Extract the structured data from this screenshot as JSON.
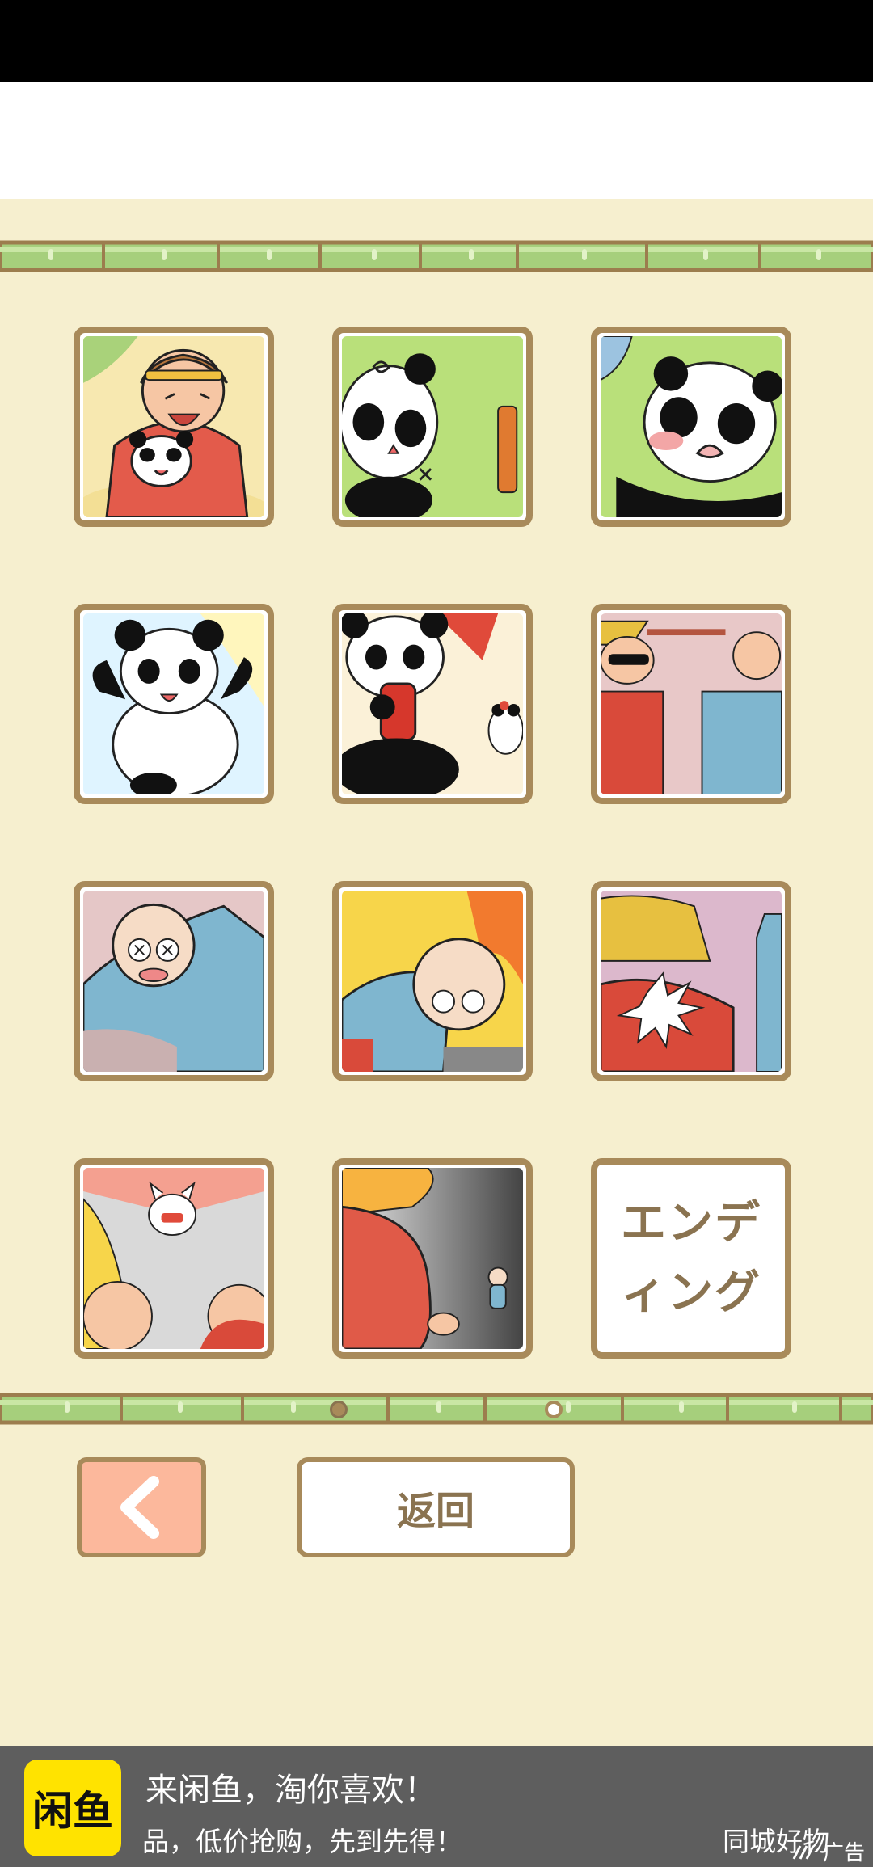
{
  "gallery": {
    "tiles": [
      {
        "name": "monkey-hugging-panda",
        "bg": "#f7e8b0"
      },
      {
        "name": "panda-dizzy",
        "bg": "#b9e07a"
      },
      {
        "name": "panda-crying",
        "bg": "#b9e07a"
      },
      {
        "name": "panda-happy",
        "bg": "#dff4ff"
      },
      {
        "name": "panda-with-bomb",
        "bg": "#fbf1d8"
      },
      {
        "name": "workers-standoff",
        "bg": "#e8c8c8"
      },
      {
        "name": "old-man-knocked-out",
        "bg": "#e5c7c7"
      },
      {
        "name": "old-man-fire",
        "bg": "#f7d54a"
      },
      {
        "name": "worker-impact",
        "bg": "#dcb8cc"
      },
      {
        "name": "cat-alarm",
        "bg": "#d9d9d9"
      },
      {
        "name": "elevator-scene",
        "bg": "#8a8a8a"
      }
    ],
    "ending_tile": {
      "line1": "エンデ",
      "line2": "ィング"
    }
  },
  "pagination": {
    "pages": 2,
    "current": 1
  },
  "controls": {
    "back_icon": "chevron-left-icon",
    "return_label": "返回"
  },
  "ad": {
    "logo_text": "闲鱼",
    "headline": "来闲鱼，淘你喜欢！",
    "subline": "品，低价抢购，先到先得！",
    "right_text": "同城好物",
    "label": "广告"
  },
  "colors": {
    "background": "#f6efcf",
    "frame": "#a88a5a",
    "text_brown": "#8a7350",
    "bamboo": "#a6cf7c",
    "back_button": "#fcb89c",
    "ad_bg": "#5e5e5e",
    "ad_logo": "#ffe300"
  }
}
